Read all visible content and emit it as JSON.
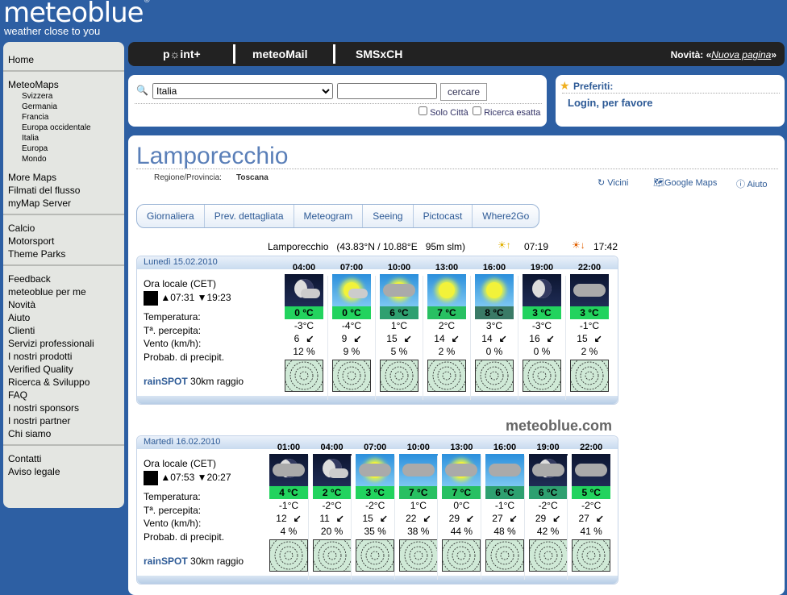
{
  "brand": {
    "name": "meteoblue",
    "tagline": "weather close to you",
    "watermark": "meteoblue.com"
  },
  "sidebar": {
    "groups": [
      {
        "items": [
          {
            "label": "Home"
          }
        ]
      },
      {
        "items": [
          {
            "label": "MeteoMaps"
          },
          {
            "label": "Svizzera",
            "sub": true
          },
          {
            "label": "Germania",
            "sub": true
          },
          {
            "label": "Francia",
            "sub": true
          },
          {
            "label": "Europa occidentale",
            "sub": true
          },
          {
            "label": "Italia",
            "sub": true
          },
          {
            "label": "Europa",
            "sub": true
          },
          {
            "label": "Mondo",
            "sub": true
          },
          {
            "label": "More Maps"
          },
          {
            "label": "Filmati del flusso"
          },
          {
            "label": "myMap Server"
          }
        ]
      },
      {
        "items": [
          {
            "label": "Calcio"
          },
          {
            "label": "Motorsport"
          },
          {
            "label": "Theme Parks"
          }
        ]
      },
      {
        "items": [
          {
            "label": "Feedback"
          },
          {
            "label": "meteoblue per me"
          },
          {
            "label": "Novità"
          },
          {
            "label": "Aiuto"
          },
          {
            "label": "Clienti"
          },
          {
            "label": "Servizi professionali"
          },
          {
            "label": "I nostri prodotti"
          },
          {
            "label": "Verified Quality"
          },
          {
            "label": "Ricerca & Sviluppo"
          },
          {
            "label": "FAQ"
          },
          {
            "label": "I nostri sponsors"
          },
          {
            "label": "I nostri partner"
          },
          {
            "label": "Chi siamo"
          }
        ]
      },
      {
        "items": [
          {
            "label": "Contatti"
          },
          {
            "label": "Aviso legale"
          }
        ]
      }
    ]
  },
  "topbar": {
    "links": [
      "p☼int+",
      "meteoMail",
      "SMSxCH"
    ],
    "novita_label": "Novità: «",
    "novita_link": "Nuova pagina",
    "novita_end": "»"
  },
  "search": {
    "country": "Italia",
    "query": "",
    "button": "cercare",
    "solo_citta": "Solo Città",
    "ricerca_esatta": "Ricerca esatta"
  },
  "preferiti": {
    "title": "Preferiti:",
    "login": "Login, per favore"
  },
  "location": {
    "name": "Lamporecchio",
    "region_label": "Regione/Provincia:",
    "region": "Toscana",
    "actions": [
      "Vicini",
      "Google Maps",
      "Aiuto"
    ],
    "coords": "Lamporecchio   (43.83°N / 10.88°E   95m slm)",
    "sunrise": "07:19",
    "sunset": "17:42"
  },
  "tabs": [
    "Giornaliera",
    "Prev. dettagliata",
    "Meteogram",
    "Seeing",
    "Pictocast",
    "Where2Go"
  ],
  "labels": {
    "local_time": "Ora locale (CET)",
    "temp": "Temperatura:",
    "felt": "Tª. percepita:",
    "wind": "Vento (km/h):",
    "precip": "Probab. di precipit.",
    "rainspot": "rainSPOT",
    "radius": "30km raggio"
  },
  "days": [
    {
      "date": "Lunedì 15.02.2010",
      "moonrise": "07:31",
      "moonset": "19:23",
      "hours": [
        "04:00",
        "07:00",
        "10:00",
        "13:00",
        "16:00",
        "19:00",
        "22:00"
      ],
      "icons": [
        "night-moon-cloud",
        "day-sun-cloud",
        "day-sun-haze",
        "day-sun",
        "day-sun",
        "night-moon",
        "night-cloudy"
      ],
      "temp": [
        "0 °C",
        "0 °C",
        "6 °C",
        "7 °C",
        "8 °C",
        "3 °C",
        "3 °C"
      ],
      "temp_colors": [
        "#22d35e",
        "#22d35e",
        "#2ea070",
        "#28c062",
        "#3a7a66",
        "#22d35e",
        "#22d35e"
      ],
      "felt": [
        "-3°C",
        "-4°C",
        "1°C",
        "2°C",
        "3°C",
        "-3°C",
        "-1°C"
      ],
      "wind": [
        "6",
        "9",
        "15",
        "14",
        "14",
        "16",
        "15"
      ],
      "wind_dir": [
        "↙",
        "↙",
        "↙",
        "↙",
        "↙",
        "↙",
        "↙"
      ],
      "precip": [
        "12 %",
        "9 %",
        "5 %",
        "2 %",
        "0 %",
        "0 %",
        "2 %"
      ]
    },
    {
      "date": "Martedì 16.02.2010",
      "moonrise": "07:53",
      "moonset": "20:27",
      "hours": [
        "01:00",
        "04:00",
        "07:00",
        "10:00",
        "13:00",
        "16:00",
        "19:00",
        "22:00"
      ],
      "icons": [
        "night-moon-overcast",
        "night-moon-cloud",
        "day-sun-haze-cloud",
        "day-cloudy",
        "day-sun-overcast",
        "day-cloudy",
        "night-moon-overcast",
        "night-cloudy"
      ],
      "temp": [
        "4 °C",
        "2 °C",
        "3 °C",
        "7 °C",
        "7 °C",
        "6 °C",
        "6 °C",
        "5 °C"
      ],
      "temp_colors": [
        "#22d35e",
        "#22d35e",
        "#22d35e",
        "#28c062",
        "#28c062",
        "#2ea070",
        "#2ea070",
        "#22d35e"
      ],
      "felt": [
        "-1°C",
        "-2°C",
        "-2°C",
        "1°C",
        "0°C",
        "-1°C",
        "-2°C",
        "-2°C"
      ],
      "wind": [
        "12",
        "11",
        "15",
        "22",
        "29",
        "27",
        "29",
        "27"
      ],
      "wind_dir": [
        "↙",
        "↙",
        "↙",
        "↙",
        "↙",
        "↙",
        "↙",
        "↙"
      ],
      "precip": [
        "4 %",
        "20 %",
        "35 %",
        "38 %",
        "44 %",
        "48 %",
        "42 %",
        "41 %"
      ]
    }
  ]
}
